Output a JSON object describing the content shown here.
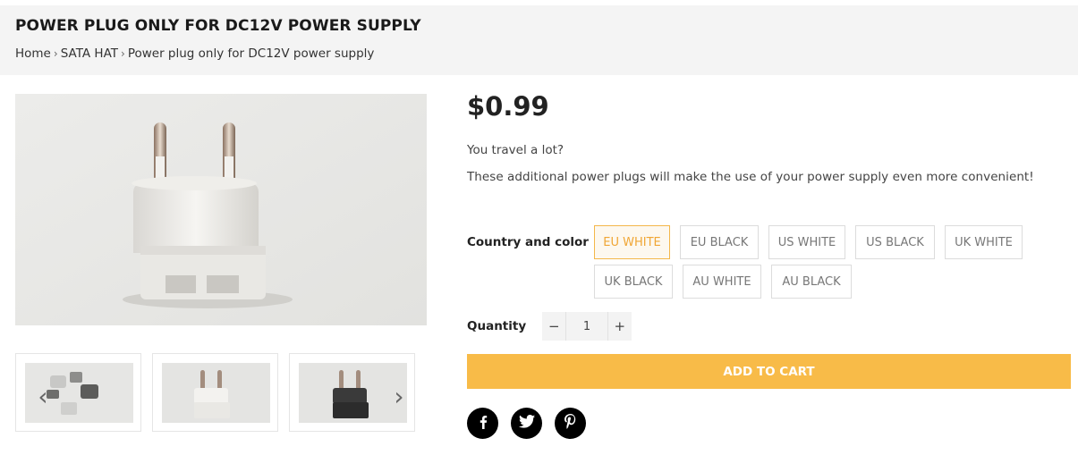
{
  "header": {
    "title": "POWER PLUG ONLY FOR DC12V POWER SUPPLY",
    "breadcrumb": [
      {
        "label": "Home"
      },
      {
        "label": "SATA HAT"
      },
      {
        "label": "Power plug only for DC12V power supply"
      }
    ],
    "separator": "›"
  },
  "gallery": {
    "prev_icon": "chevron-left-icon",
    "next_icon": "chevron-right-icon",
    "prev_glyph": "‹",
    "next_glyph": "›"
  },
  "product": {
    "price": "$0.99",
    "description": [
      "You travel a lot?",
      "These additional power plugs will make the use of your power supply even more convenient!"
    ],
    "option_label": "Country and color",
    "options": [
      {
        "label": "EU WHITE",
        "selected": true
      },
      {
        "label": "EU BLACK",
        "selected": false
      },
      {
        "label": "US WHITE",
        "selected": false
      },
      {
        "label": "US BLACK",
        "selected": false
      },
      {
        "label": "UK WHITE",
        "selected": false
      },
      {
        "label": "UK BLACK",
        "selected": false
      },
      {
        "label": "AU WHITE",
        "selected": false
      },
      {
        "label": "AU BLACK",
        "selected": false
      }
    ],
    "quantity_label": "Quantity",
    "quantity": "1",
    "qty_minus": "−",
    "qty_plus": "+",
    "add_to_cart": "ADD TO CART"
  },
  "social": [
    {
      "icon": "facebook-icon"
    },
    {
      "icon": "twitter-icon"
    },
    {
      "icon": "pinterest-icon"
    }
  ],
  "colors": {
    "accent": "#f8bb48",
    "selected_text": "#f0a635",
    "header_bg": "#f4f4f4"
  }
}
